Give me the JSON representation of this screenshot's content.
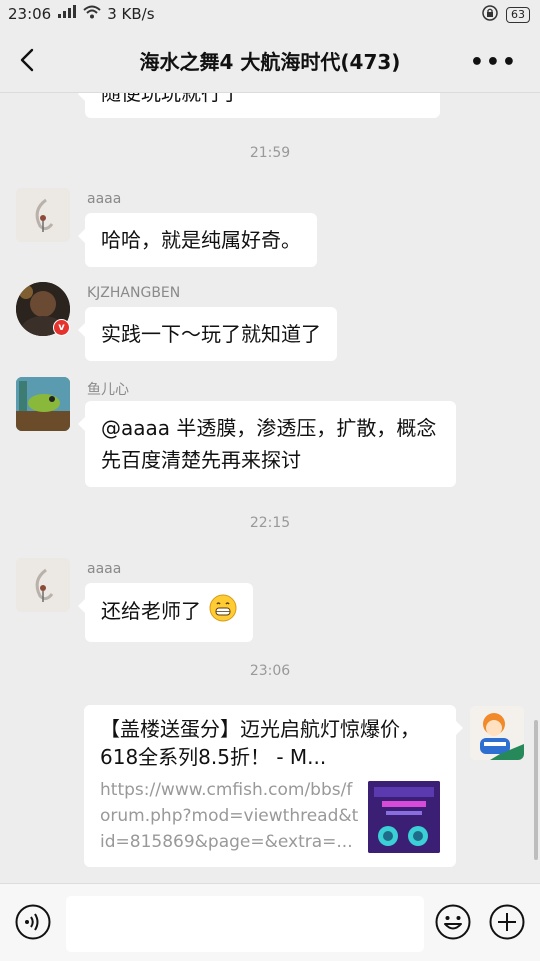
{
  "status_bar": {
    "time": "23:06",
    "network": "3 KB/s",
    "battery": "63"
  },
  "header": {
    "title": "海水之舞4 大航海时代(473)"
  },
  "chat": {
    "partial_message": "随便玩玩就行了",
    "timestamps": [
      "21:59",
      "22:15",
      "23:06"
    ],
    "messages": [
      {
        "sender": "aaaa",
        "text": "哈哈，就是纯属好奇。"
      },
      {
        "sender": "KJZHANGBEN",
        "text": "实践一下～玩了就知道了"
      },
      {
        "sender": "鱼儿心",
        "text": "@aaaa 半透膜，渗透压，扩散，概念先百度清楚先再来探讨"
      },
      {
        "sender": "aaaa",
        "text": "还给老师了"
      }
    ],
    "link_card": {
      "title": "【盖楼送蛋分】迈光启航灯惊爆价，618全系列8.5折！ - M...",
      "url": "https://www.cmfish.com/bbs/forum.php?mod=viewthread&tid=815869&page=&extra=..."
    }
  },
  "input": {
    "placeholder": ""
  },
  "icons": {
    "back": "back-arrow-icon",
    "more": "more-icon",
    "voice": "voice-icon",
    "emoji": "emoji-icon",
    "plus": "plus-icon"
  }
}
